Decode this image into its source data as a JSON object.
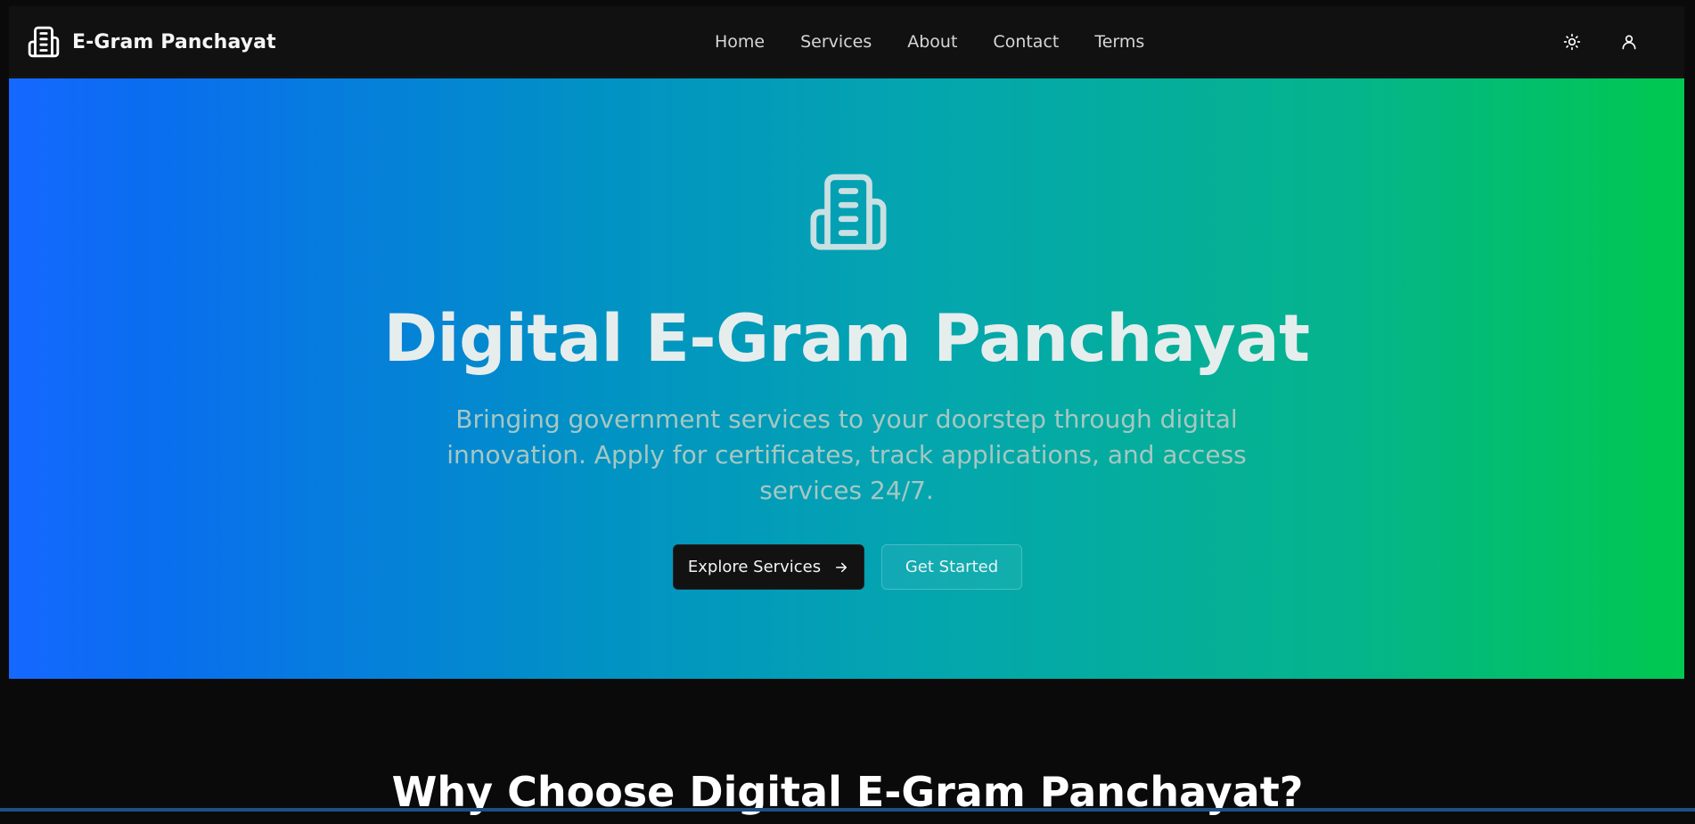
{
  "navbar": {
    "brand": "E-Gram Panchayat",
    "brand_icon": "building-icon",
    "links": [
      "Home",
      "Services",
      "About",
      "Contact",
      "Terms"
    ],
    "theme_icon": "sun-icon",
    "user_icon": "user-icon"
  },
  "hero": {
    "icon": "building-icon",
    "title": "Digital E-Gram Panchayat",
    "subtitle": "Bringing government services to your doorstep through digital innovation. Apply for certificates, track applications, and access services 24/7.",
    "primary_button": "Explore Services",
    "primary_button_icon": "arrow-right-icon",
    "secondary_button": "Get Started",
    "gradient_colors": [
      "#1668ff",
      "#0192c4",
      "#05b48c",
      "#00c84f"
    ]
  },
  "features": {
    "title": "Why Choose Digital E-Gram Panchayat?"
  },
  "colors": {
    "page_background": "#0a0a0a",
    "navbar_background": "#111111"
  }
}
